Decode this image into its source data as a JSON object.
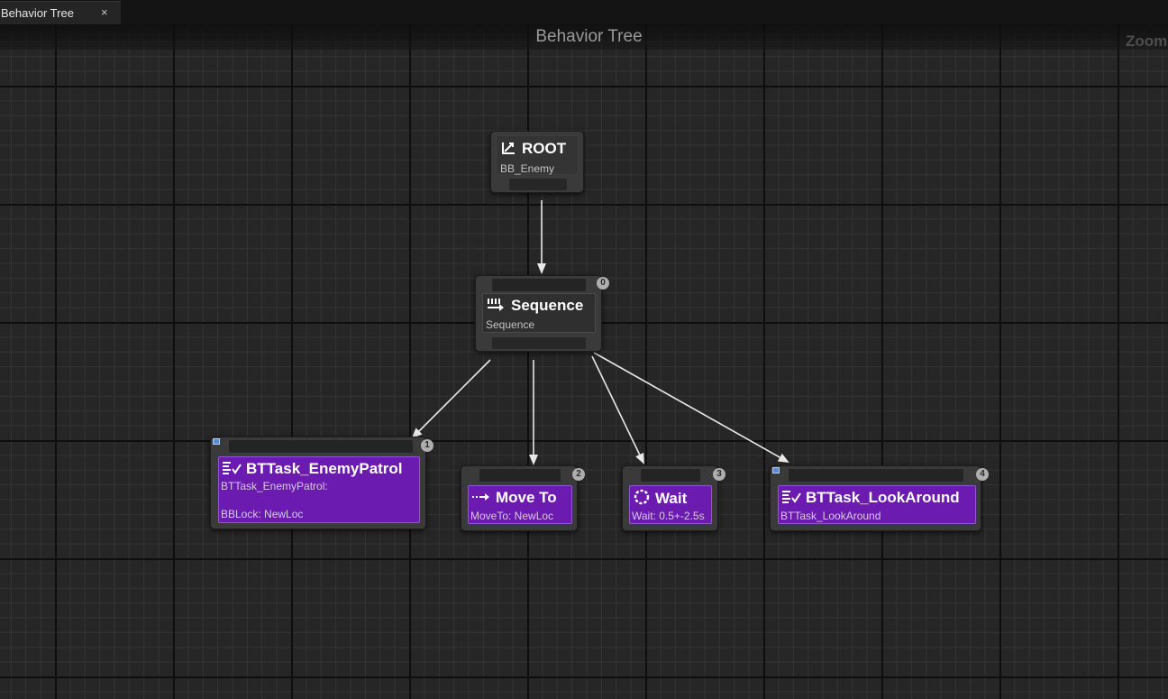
{
  "tab": {
    "label": "Behavior Tree",
    "close": "×"
  },
  "graph": {
    "title": "Behavior Tree",
    "zoom_label": "Zoom"
  },
  "colors": {
    "task_fill": "#6c1bb0",
    "node_frame": "#3a3a3a",
    "wire": "#e8e8e8",
    "badge": "#aeaeae"
  },
  "nodes": {
    "root": {
      "title": "ROOT",
      "subtitle": "BB_Enemy",
      "icon": "root-arrow-icon"
    },
    "sequence": {
      "title": "Sequence",
      "subtitle": "Sequence",
      "index": "0",
      "icon": "sequence-icon"
    },
    "enemy_patrol": {
      "title": "BTTask_EnemyPatrol",
      "subtitle": "BTTask_EnemyPatrol:",
      "detail": "BBLock: NewLoc",
      "index": "1",
      "icon": "task-icon"
    },
    "move_to": {
      "title": "Move To",
      "subtitle": "MoveTo: NewLoc",
      "index": "2",
      "icon": "move-to-icon"
    },
    "wait": {
      "title": "Wait",
      "subtitle": "Wait: 0.5+-2.5s",
      "index": "3",
      "icon": "wait-icon"
    },
    "look_around": {
      "title": "BTTask_LookAround",
      "subtitle": "BTTask_LookAround",
      "index": "4",
      "icon": "task-icon"
    }
  }
}
